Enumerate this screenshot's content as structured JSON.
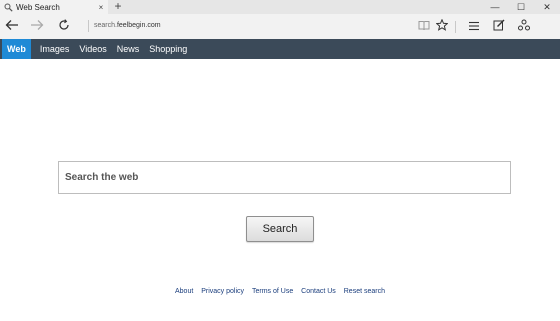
{
  "browser": {
    "tab_title": "Web Search",
    "tab_close": "×",
    "new_tab": "+",
    "window_controls": {
      "minimize": "—",
      "maximize": "☐",
      "close": "✕"
    },
    "url_prefix": "search.",
    "url_domain": "feelbegin.com",
    "icons": [
      "search-icon",
      "back-icon",
      "forward-icon",
      "refresh-icon",
      "reading-view-icon",
      "favorite-star-icon",
      "hub-icon",
      "web-note-icon",
      "share-icon"
    ]
  },
  "site_nav": {
    "items": [
      {
        "label": "Web",
        "active": true
      },
      {
        "label": "Images",
        "active": false
      },
      {
        "label": "Videos",
        "active": false
      },
      {
        "label": "News",
        "active": false
      },
      {
        "label": "Shopping",
        "active": false
      }
    ]
  },
  "search": {
    "placeholder": "Search the web",
    "value": "",
    "button_label": "Search"
  },
  "footer": {
    "links": [
      "About",
      "Privacy policy",
      "Terms of Use",
      "Contact Us",
      "Reset search"
    ]
  },
  "colors": {
    "nav_bar": "#3b4a59",
    "nav_active": "#1f8ad6",
    "footer_link": "#1a3d7c"
  }
}
